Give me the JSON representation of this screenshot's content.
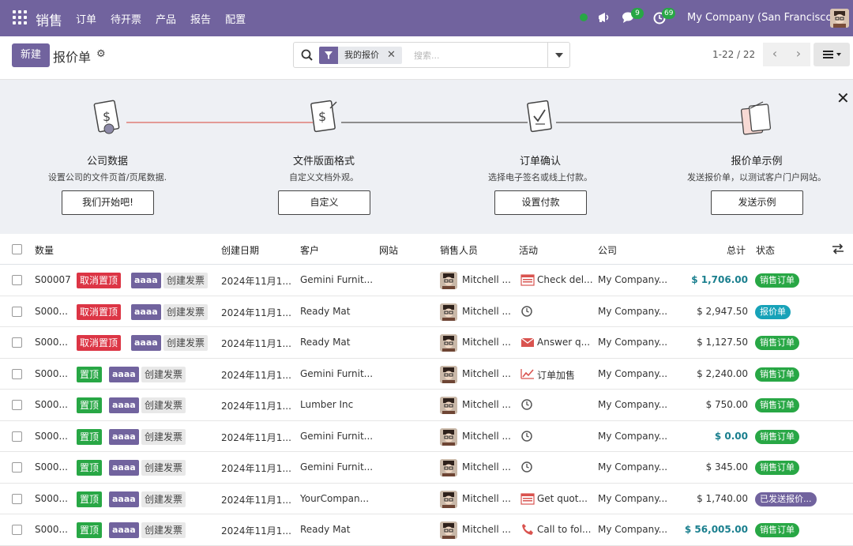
{
  "topbar": {
    "app_name": "销售",
    "menu": [
      "订单",
      "待开票",
      "产品",
      "报告",
      "配置"
    ],
    "messages_count": "9",
    "activities_count": "69",
    "company": "My Company (San Francisco)"
  },
  "control": {
    "new_label": "新建",
    "title": "报价单",
    "facet_label": "我的报价",
    "search_placeholder": "搜索...",
    "pager": "1-22 / 22"
  },
  "onboarding": {
    "steps": [
      {
        "title": "公司数据",
        "desc": "设置公司的文件页首/页尾数据.",
        "button": "我们开始吧!"
      },
      {
        "title": "文件版面格式",
        "desc": "自定义文档外观。",
        "button": "自定义"
      },
      {
        "title": "订单确认",
        "desc": "选择电子签名或线上付款。",
        "button": "设置付款"
      },
      {
        "title": "报价单示例",
        "desc": "发送报价单，以测试客户门户网站。",
        "button": "发送示例"
      }
    ]
  },
  "table": {
    "headers": {
      "number": "数量",
      "date": "创建日期",
      "customer": "客户",
      "website": "网站",
      "salesperson": "销售人员",
      "activity": "活动",
      "company": "公司",
      "total": "总计",
      "status": "状态"
    },
    "rows": [
      {
        "number": "S00007",
        "pin": "取消置顶",
        "pin_color": "red",
        "tag": "aaaa",
        "invoice": "创建发票",
        "date": "2024年11月1...",
        "customer": "Gemini Furnit...",
        "salesperson": "Mitchell ...",
        "activity_icon": "calendar-icon",
        "activity": "Check del...",
        "company": "My Company...",
        "total": "$ 1,706.00",
        "total_teal": true,
        "status": "销售订单",
        "status_color": "green"
      },
      {
        "number": "S000...",
        "pin": "取消置顶",
        "pin_color": "red",
        "tag": "aaaa",
        "invoice": "创建发票",
        "date": "2024年11月1...",
        "customer": "Ready Mat",
        "salesperson": "Mitchell ...",
        "activity_icon": "clock-icon",
        "activity": "",
        "company": "My Company...",
        "total": "$ 2,947.50",
        "total_teal": false,
        "status": "报价单",
        "status_color": "teal"
      },
      {
        "number": "S000...",
        "pin": "取消置顶",
        "pin_color": "red",
        "tag": "aaaa",
        "invoice": "创建发票",
        "date": "2024年11月1...",
        "customer": "Ready Mat",
        "salesperson": "Mitchell ...",
        "activity_icon": "envelope-icon",
        "activity": "Answer q...",
        "company": "My Company...",
        "total": "$ 1,127.50",
        "total_teal": false,
        "status": "销售订单",
        "status_color": "green"
      },
      {
        "number": "S000...",
        "pin": "置顶",
        "pin_color": "green",
        "tag": "aaaa",
        "invoice": "创建发票",
        "date": "2024年11月1...",
        "customer": "Gemini Furnit...",
        "salesperson": "Mitchell ...",
        "activity_icon": "trend-icon",
        "activity": "订单加售",
        "company": "My Company...",
        "total": "$ 2,240.00",
        "total_teal": false,
        "status": "销售订单",
        "status_color": "green"
      },
      {
        "number": "S000...",
        "pin": "置顶",
        "pin_color": "green",
        "tag": "aaaa",
        "invoice": "创建发票",
        "date": "2024年11月1...",
        "customer": "Lumber Inc",
        "salesperson": "Mitchell ...",
        "activity_icon": "clock-icon",
        "activity": "",
        "company": "My Company...",
        "total": "$ 750.00",
        "total_teal": false,
        "status": "销售订单",
        "status_color": "green"
      },
      {
        "number": "S000...",
        "pin": "置顶",
        "pin_color": "green",
        "tag": "aaaa",
        "invoice": "创建发票",
        "date": "2024年11月1...",
        "customer": "Gemini Furnit...",
        "salesperson": "Mitchell ...",
        "activity_icon": "clock-icon",
        "activity": "",
        "company": "My Company...",
        "total": "$ 0.00",
        "total_teal": true,
        "status": "销售订单",
        "status_color": "green"
      },
      {
        "number": "S000...",
        "pin": "置顶",
        "pin_color": "green",
        "tag": "aaaa",
        "invoice": "创建发票",
        "date": "2024年11月1...",
        "customer": "Gemini Furnit...",
        "salesperson": "Mitchell ...",
        "activity_icon": "clock-icon",
        "activity": "",
        "company": "My Company...",
        "total": "$ 345.00",
        "total_teal": false,
        "status": "销售订单",
        "status_color": "green"
      },
      {
        "number": "S000...",
        "pin": "置顶",
        "pin_color": "green",
        "tag": "aaaa",
        "invoice": "创建发票",
        "date": "2024年11月1...",
        "customer": "YourCompan...",
        "salesperson": "Mitchell ...",
        "activity_icon": "calendar-icon",
        "activity": "Get quot...",
        "company": "My Company...",
        "total": "$ 1,740.00",
        "total_teal": false,
        "status": "已发送报价...",
        "status_color": "purple"
      },
      {
        "number": "S000...",
        "pin": "置顶",
        "pin_color": "green",
        "tag": "aaaa",
        "invoice": "创建发票",
        "date": "2024年11月1...",
        "customer": "Ready Mat",
        "salesperson": "Mitchell ...",
        "activity_icon": "phone-icon",
        "activity": "Call to fol...",
        "company": "My Company...",
        "total": "$ 56,005.00",
        "total_teal": true,
        "status": "销售订单",
        "status_color": "green"
      }
    ]
  }
}
